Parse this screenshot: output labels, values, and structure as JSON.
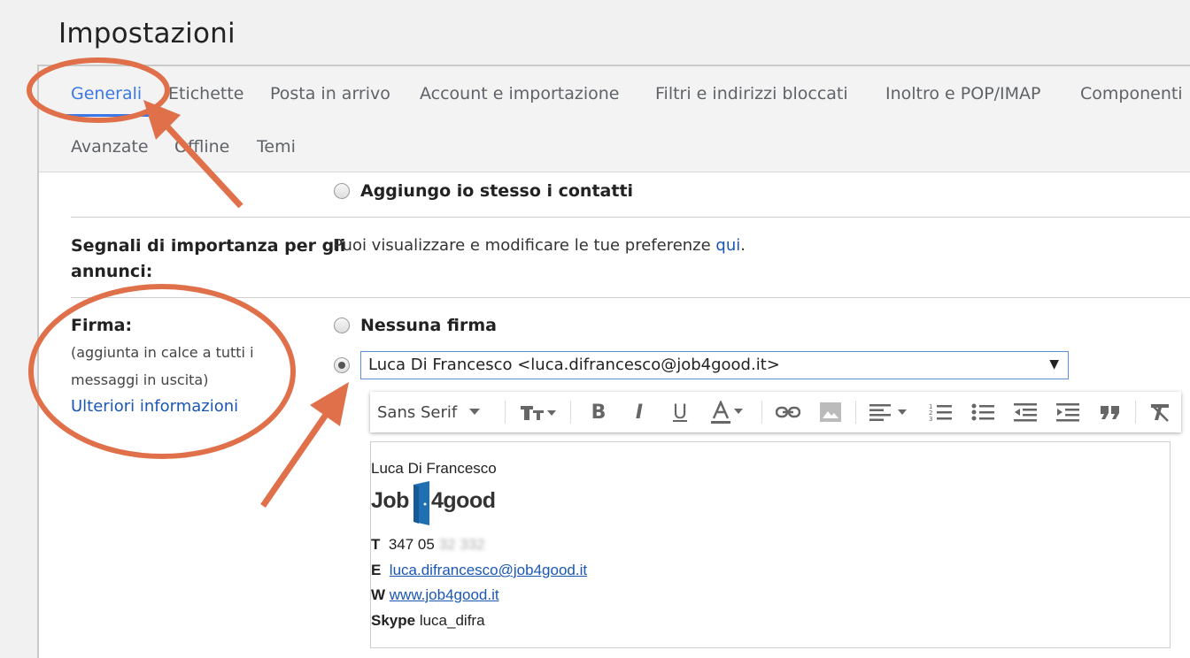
{
  "page": {
    "title": "Impostazioni"
  },
  "tabs": [
    {
      "label": "Generali",
      "active": true
    },
    {
      "label": "Etichette"
    },
    {
      "label": "Posta in arrivo"
    },
    {
      "label": "Account e importazione"
    },
    {
      "label": "Filtri e indirizzi bloccati"
    },
    {
      "label": "Inoltro e POP/IMAP"
    },
    {
      "label": "Componenti"
    },
    {
      "label": "Avanzate"
    },
    {
      "label": "Offline"
    },
    {
      "label": "Temi"
    }
  ],
  "contacts": {
    "option_label": "Aggiungo io stesso i contatti"
  },
  "ads": {
    "label_line1": "Segnali di importanza per gli",
    "label_line2": "annunci:",
    "text": "Puoi visualizzare e modificare le tue preferenze ",
    "link": "qui",
    "suffix": "."
  },
  "signature": {
    "label": "Firma:",
    "desc_line1": "(aggiunta in calce a tutti i",
    "desc_line2": "messaggi in uscita)",
    "more_link": "Ulteriori informazioni",
    "none_option": "Nessuna firma",
    "selected_account": "Luca Di Francesco <luca.difrancesco@job4good.it>",
    "caret": "▼",
    "toolbar": {
      "font": "Sans Serif",
      "icons": [
        "font-size-icon",
        "bold-icon",
        "italic-icon",
        "underline-icon",
        "text-color-icon",
        "link-icon",
        "image-icon",
        "align-icon",
        "numbered-list-icon",
        "bulleted-list-icon",
        "indent-less-icon",
        "indent-more-icon",
        "quote-icon",
        "remove-formatting-icon"
      ]
    },
    "body": {
      "name": "Luca Di Francesco",
      "logo_left": "Job",
      "logo_right": "4good",
      "phone_label": "T",
      "phone_value": "347 05",
      "phone_hidden": " 32 332",
      "email_label": "E",
      "email_value": "luca.difrancesco@job4good.it",
      "web_label": "W",
      "web_value": "www.job4good.it",
      "skype_label": "Skype",
      "skype_value": "luca_difra"
    }
  },
  "annotation_color": "#e0704a",
  "accent_color": "#3b78e7"
}
